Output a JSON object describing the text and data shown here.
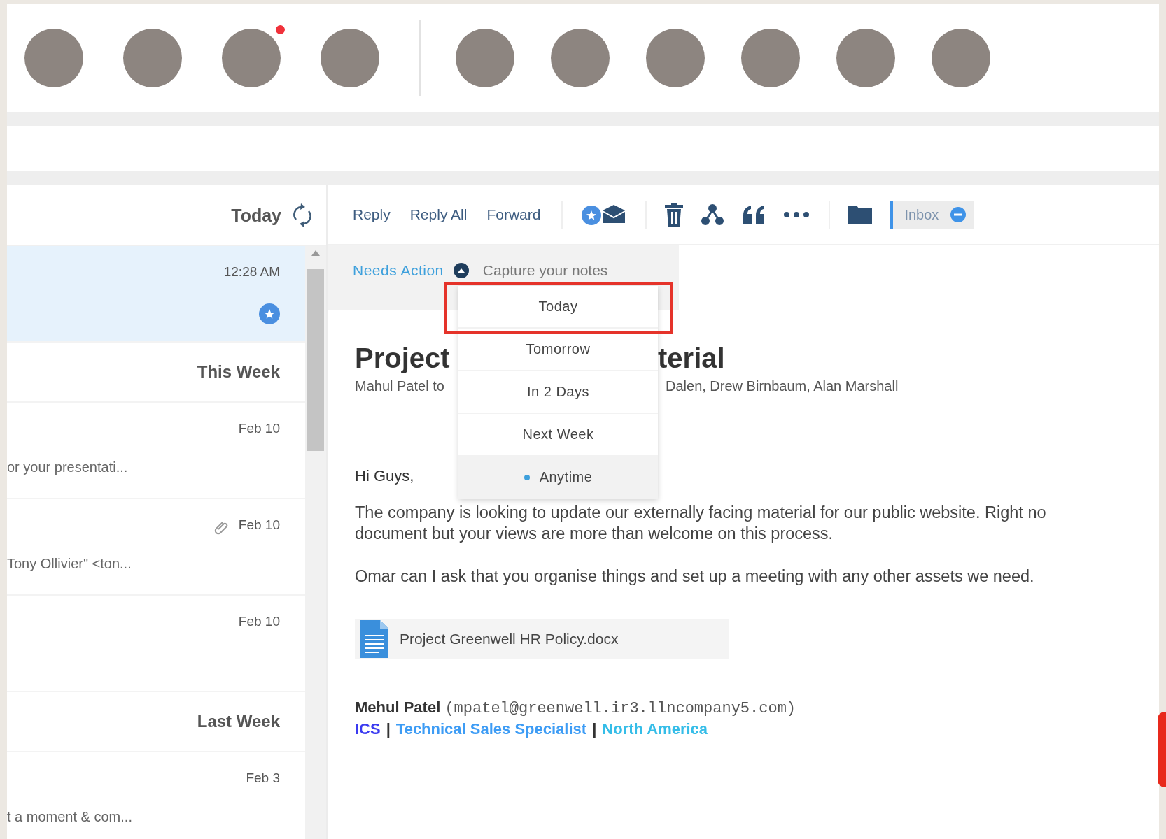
{
  "avatar_groups": [
    {
      "avatars": [
        {
          "notification": false
        },
        {
          "notification": false
        },
        {
          "notification": true
        },
        {
          "notification": false
        }
      ]
    },
    {
      "avatars": [
        {
          "notification": false
        },
        {
          "notification": false
        },
        {
          "notification": false
        },
        {
          "notification": false
        },
        {
          "notification": false
        },
        {
          "notification": false
        }
      ]
    }
  ],
  "message_list": {
    "header": "Today",
    "items": [
      {
        "kind": "message",
        "time": "12:28 AM",
        "selected": true,
        "starred": true,
        "attachment": false
      },
      {
        "kind": "group",
        "title": "This Week"
      },
      {
        "kind": "message",
        "time": "Feb 10",
        "preview": "or your presentati...",
        "selected": false,
        "starred": false,
        "attachment": false
      },
      {
        "kind": "message",
        "time": "Feb 10",
        "preview": "Tony Ollivier\" <ton...",
        "selected": false,
        "starred": false,
        "attachment": true
      },
      {
        "kind": "message",
        "time": "Feb 10",
        "selected": false,
        "starred": false,
        "attachment": false
      },
      {
        "kind": "group",
        "title": "Last Week"
      },
      {
        "kind": "message",
        "time": "Feb 3",
        "preview": "t a moment & com...",
        "selected": false,
        "starred": false,
        "attachment": false
      }
    ]
  },
  "toolbar": {
    "actions": [
      "Reply",
      "Reply All",
      "Forward"
    ],
    "folder_chip": "Inbox"
  },
  "action_bar": {
    "status": "Needs Action",
    "notes_placeholder": "Capture your notes"
  },
  "due_menu": [
    {
      "label": "Today",
      "selected": false,
      "outlined": true
    },
    {
      "label": "Tomorrow",
      "selected": false,
      "outlined": false
    },
    {
      "label": "In 2 Days",
      "selected": false,
      "outlined": false
    },
    {
      "label": "Next Week",
      "selected": false,
      "outlined": false
    },
    {
      "label": "Anytime",
      "selected": true,
      "outlined": false
    }
  ],
  "email": {
    "subject_start": "Project",
    "subject_end": "terial",
    "from_start": "Mahul Patel to",
    "recipients_end": "Dalen, Drew Birnbaum, Alan Marshall",
    "greeting": "Hi Guys,",
    "paragraphs": [
      "The company is looking to update our externally facing material for our public website. Right no\ndocument but your views are more than welcome on this process.",
      "Omar can I ask that you organise things and set up a meeting with any other assets we need."
    ],
    "attachment": {
      "name": "Project Greenwell HR Policy.docx"
    },
    "signature": {
      "name": "Mehul Patel",
      "email": "(mpatel@greenwell.ir3.llncompany5.com)",
      "parts": [
        {
          "text": "ICS",
          "color": "#3b3bf0"
        },
        {
          "text": "|",
          "color": "#333333"
        },
        {
          "text": "Technical Sales Specialist",
          "color": "#3d9cf5"
        },
        {
          "text": "|",
          "color": "#333333"
        },
        {
          "text": "North America",
          "color": "#35bde8"
        }
      ]
    }
  }
}
